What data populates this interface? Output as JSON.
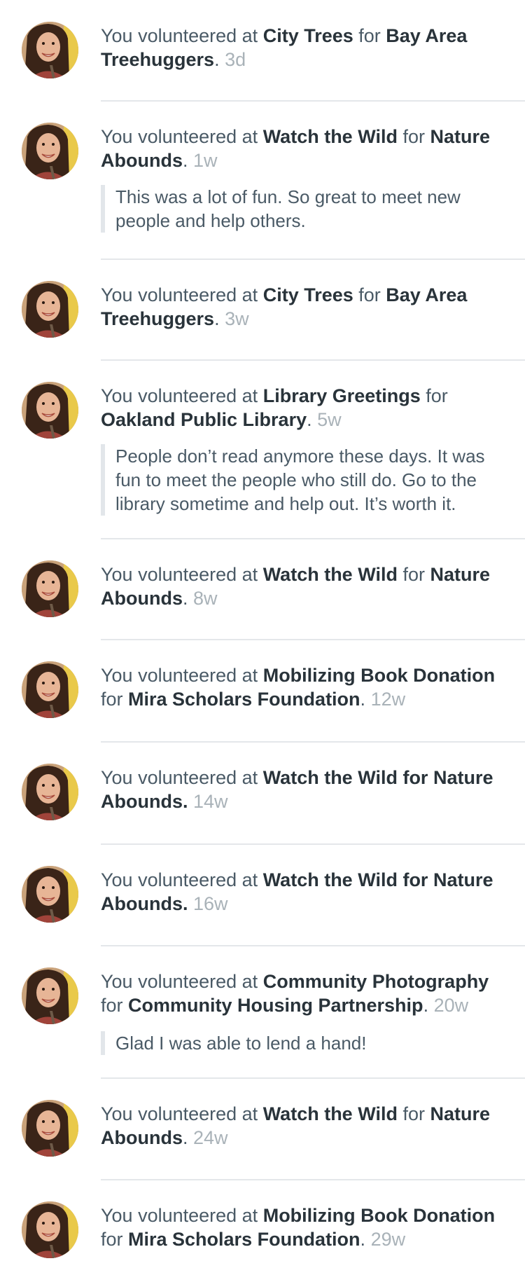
{
  "feed": {
    "entries": [
      {
        "prefix": "You volunteered at ",
        "activity": "City Trees",
        "joiner": " for ",
        "org": "Bay Area Treehuggers",
        "end": ".",
        "time": " 3d",
        "quote": ""
      },
      {
        "prefix": "You volunteered at ",
        "activity": "Watch the Wild",
        "joiner": " for ",
        "org": "Nature Abounds",
        "end": ".",
        "time": " 1w",
        "quote": "This was a lot of fun. So great to meet new people and help others."
      },
      {
        "prefix": "You volunteered at ",
        "activity": "City Trees",
        "joiner": " for ",
        "org": "Bay Area Treehuggers",
        "end": ".",
        "time": " 3w",
        "quote": ""
      },
      {
        "prefix": "You volunteered at ",
        "activity": "Library Greetings",
        "joiner": " for ",
        "org": "Oakland Public Library",
        "end": ".",
        "time": " 5w",
        "quote": "People don’t read anymore these days. It was fun to meet the people who still do. Go to the library sometime and help out. It’s worth it."
      },
      {
        "prefix": "You volunteered at ",
        "activity": "Watch the Wild",
        "joiner": " for ",
        "org": "Nature Abounds",
        "end": ".",
        "time": " 8w",
        "quote": ""
      },
      {
        "prefix": "You volunteered at ",
        "activity": "Mobilizing Book Donation",
        "joiner": " for ",
        "org": "Mira Scholars Foundation",
        "end": ".",
        "time": " 12w",
        "quote": ""
      },
      {
        "prefix": "You volunteered at ",
        "activity": "Watch the Wild for Nature Abounds.",
        "joiner": "",
        "org": "",
        "end": "",
        "time": " 14w",
        "quote": ""
      },
      {
        "prefix": "You volunteered at ",
        "activity": "Watch the Wild for Nature Abounds.",
        "joiner": "",
        "org": "",
        "end": "",
        "time": " 16w",
        "quote": ""
      },
      {
        "prefix": "You volunteered at ",
        "activity": "Community Photography",
        "joiner": " for ",
        "org": "Community Housing Partnership",
        "end": ".",
        "time": " 20w",
        "quote": "Glad I was able to lend a hand!"
      },
      {
        "prefix": "You volunteered at ",
        "activity": "Watch the Wild",
        "joiner": " for ",
        "org": "Nature Abounds",
        "end": ".",
        "time": " 24w",
        "quote": ""
      },
      {
        "prefix": "You volunteered at ",
        "activity": "Mobilizing Book Donation",
        "joiner": " for ",
        "org": "Mira Scholars Foundation",
        "end": ".",
        "time": " 29w",
        "quote": ""
      }
    ]
  },
  "colors": {
    "body_text": "#4a5a66",
    "bold_text": "#29333a",
    "timestamp": "#a9b2b8",
    "divider": "#e4e7ea",
    "quote_bar": "#e2e6ea"
  },
  "icons": {
    "avatar": "user-avatar-photo"
  }
}
